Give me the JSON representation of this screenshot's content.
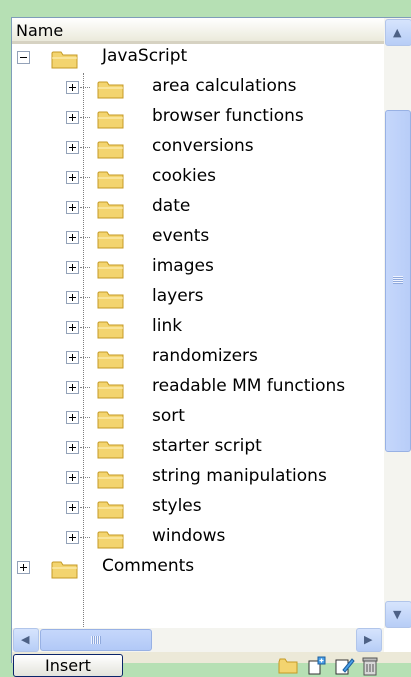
{
  "header": {
    "name_label": "Name"
  },
  "root": {
    "label": "JavaScript",
    "expanded": true
  },
  "children": [
    {
      "label": "area calculations"
    },
    {
      "label": "browser functions"
    },
    {
      "label": "conversions"
    },
    {
      "label": "cookies"
    },
    {
      "label": "date"
    },
    {
      "label": "events"
    },
    {
      "label": "images"
    },
    {
      "label": "layers"
    },
    {
      "label": "link"
    },
    {
      "label": "randomizers"
    },
    {
      "label": "readable MM functions"
    },
    {
      "label": "sort"
    },
    {
      "label": "starter script"
    },
    {
      "label": "string manipulations"
    },
    {
      "label": "styles"
    },
    {
      "label": "windows"
    }
  ],
  "sibling": {
    "label": "Comments"
  },
  "footer": {
    "insert_label": "Insert"
  },
  "icons": [
    "new-folder-icon",
    "new-item-icon",
    "edit-icon",
    "delete-icon"
  ],
  "colors": {
    "folder": "#f3d46f",
    "folder_edge": "#c59a24",
    "scroll": "#b8cdf8",
    "background": "#b6e0b4"
  }
}
